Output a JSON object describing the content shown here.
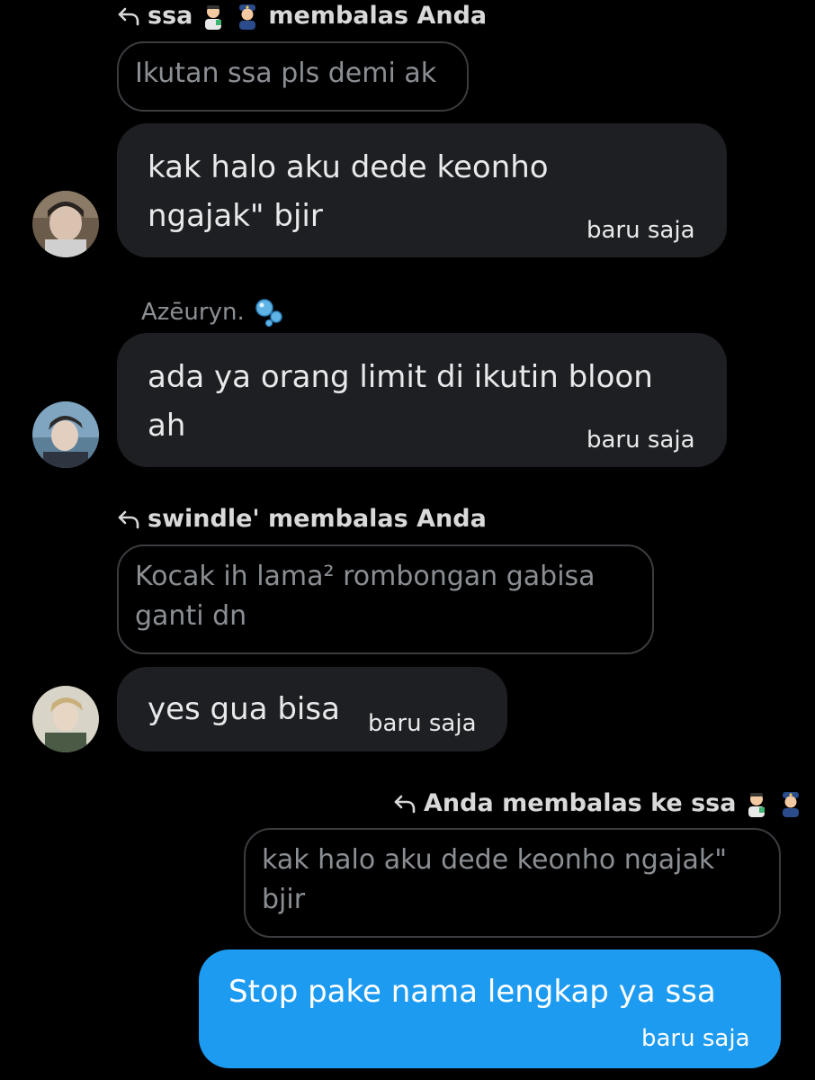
{
  "messages": [
    {
      "reply_label": "ssa 👨‍🔬👮 membalas Anda",
      "reply_user": "ssa",
      "reply_suffix": "membalas Anda",
      "quote": "Ikutan ssa pls demi ak",
      "text_line1": "kak halo aku dede keonho",
      "text_line2": "ngajak\" bjir",
      "time": "baru saja"
    },
    {
      "sender": "Azēuryn.",
      "text_line1": "ada ya orang limit di ikutin bloon",
      "text_line2": "ah",
      "time": "baru saja"
    },
    {
      "reply_label": "swindle' membalas Anda",
      "quote_line1": "Kocak ih lama² rombongan gabisa",
      "quote_line2": "ganti dn",
      "text": "yes gua bisa",
      "time": "baru saja"
    },
    {
      "reply_label": "Anda membalas ke ssa",
      "quote_line1": "kak halo aku dede keonho ngajak\"",
      "quote_line2": "bjir",
      "text": "Stop pake nama lengkap ya ssa",
      "time": "baru saja"
    }
  ],
  "colors": {
    "background": "#000000",
    "bubble_other": "#1e1f22",
    "bubble_me": "#1d9bf0",
    "muted_text": "#8b8f94"
  },
  "icons": [
    "reply-arrow-icon",
    "emoji-scientist-icon",
    "emoji-police-icon",
    "emoji-bubbles-icon"
  ]
}
